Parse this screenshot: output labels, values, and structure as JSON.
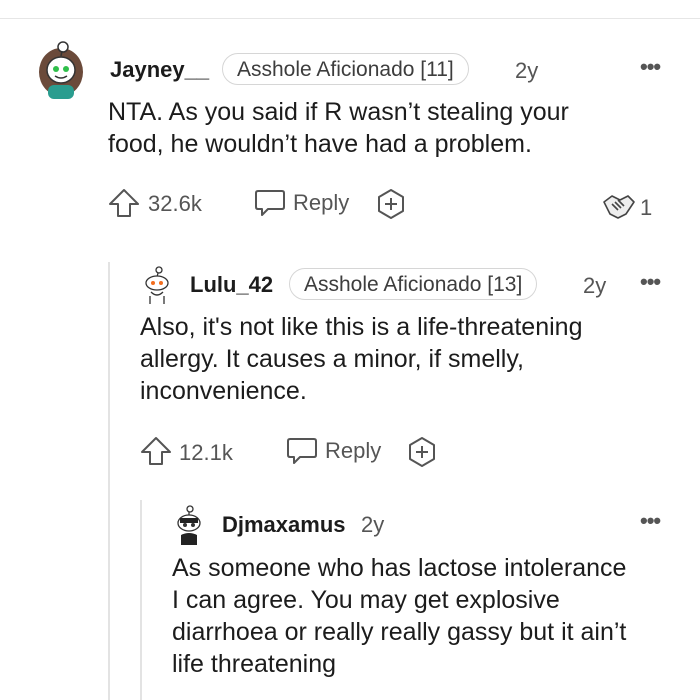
{
  "comments": [
    {
      "author": "Jayney__",
      "flair": "Asshole Aficionado [11]",
      "age": "2y",
      "body_lines": [
        "NTA. As you said if R wasn’t stealing your",
        "food, he wouldn’t have had a problem."
      ],
      "votes": "32.6k",
      "reply_label": "Reply",
      "award_count": "1"
    },
    {
      "author": "Lulu_42",
      "flair": "Asshole Aficionado [13]",
      "age": "2y",
      "body_lines": [
        "Also, it's not like this is a life-threatening",
        "allergy. It causes a minor, if smelly,",
        "inconvenience."
      ],
      "votes": "12.1k",
      "reply_label": "Reply"
    },
    {
      "author": "Djmaxamus",
      "age": "2y",
      "body_lines": [
        "As someone who has lactose intolerance",
        "I can agree. You may get explosive",
        "diarrhoea or really really gassy but it ain’t",
        "life threatening"
      ]
    }
  ],
  "icons": {
    "more": "more-options-icon",
    "upvote": "upvote-arrow-icon",
    "reply": "chat-bubble-icon",
    "award": "plus-award-icon",
    "given_award": "handshake-award-icon"
  },
  "colors": {
    "text": "#1c1c1c",
    "meta": "#555555",
    "thread_line": "#e3e3e3",
    "jayney_avatar_body": "#2a9d8f"
  }
}
